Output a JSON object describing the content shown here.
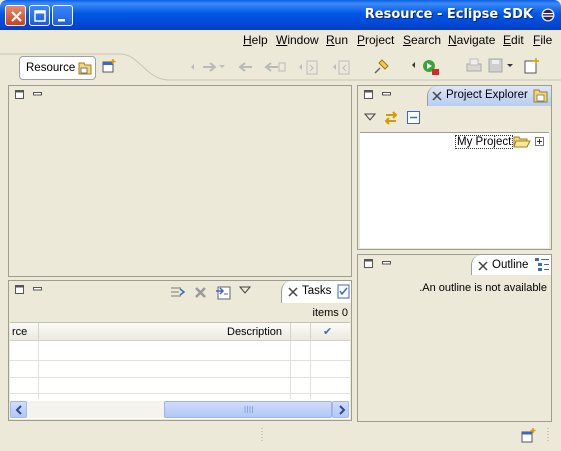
{
  "window": {
    "title": "Resource - Eclipse SDK",
    "titlebar_color": "#0058e6",
    "buttons": [
      "close-icon",
      "maximize-icon",
      "minimize-icon"
    ]
  },
  "menu": {
    "items": [
      {
        "label": "Help",
        "mnemonic": "H"
      },
      {
        "label": "Window",
        "mnemonic": "W"
      },
      {
        "label": "Run",
        "mnemonic": "R"
      },
      {
        "label": "Project",
        "mnemonic": "P"
      },
      {
        "label": "Search",
        "mnemonic": "S"
      },
      {
        "label": "Navigate",
        "mnemonic": "N"
      },
      {
        "label": "Edit",
        "mnemonic": "E"
      },
      {
        "label": "File",
        "mnemonic": "F"
      }
    ]
  },
  "toolbar": {
    "perspective_label": "Resource"
  },
  "explorer": {
    "tab_label": "Project Explorer",
    "tree_items": [
      {
        "label": "My Project",
        "icon": "folder-open-icon"
      }
    ]
  },
  "outline": {
    "tab_label": "Outline",
    "message": ".An outline is not available"
  },
  "tasks": {
    "tab_label": "Tasks",
    "items_count": "items 0",
    "columns": [
      "rce",
      "Description",
      "",
      "✔"
    ]
  },
  "colors": {
    "background": "#ece9d8",
    "active_tab": "#b7cdf1",
    "border": "#9d9d92"
  }
}
